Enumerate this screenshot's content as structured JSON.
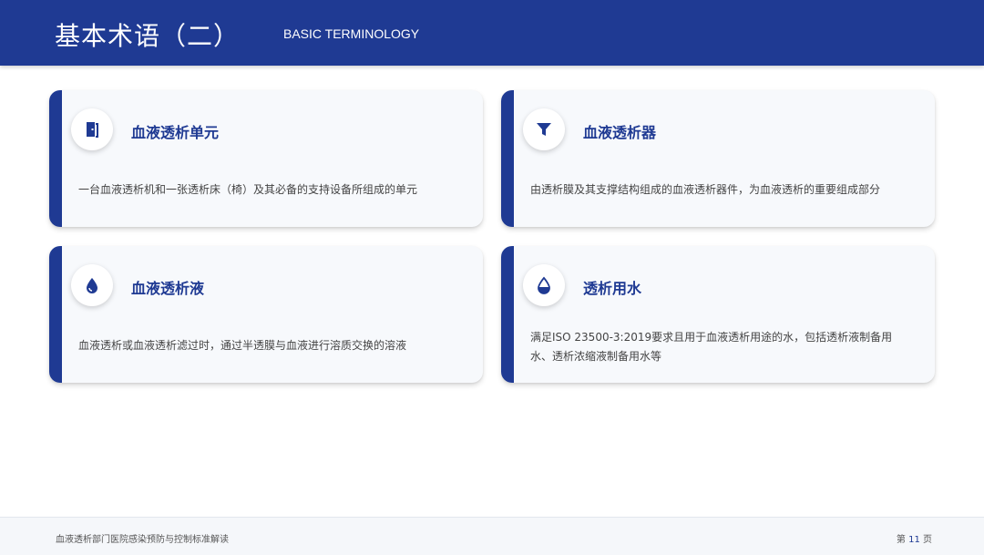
{
  "header": {
    "title": "基本术语（二）",
    "subtitle": "BASIC TERMINOLOGY"
  },
  "cards": [
    {
      "icon": "door-icon",
      "title": "血液透析单元",
      "description": "一台血液透析机和一张透析床（椅）及其必备的支持设备所组成的单元"
    },
    {
      "icon": "filter-icon",
      "title": "血液透析器",
      "description": "由透析膜及其支撑结构组成的血液透析器件，为血液透析的重要组成部分"
    },
    {
      "icon": "drop-icon",
      "title": "血液透析液",
      "description": "血液透析或血液透析滤过时，通过半透膜与血液进行溶质交换的溶液"
    },
    {
      "icon": "half-drop-icon",
      "title": "透析用水",
      "description": "满足ISO 23500-3:2019要求且用于血液透析用途的水，包括透析液制备用水、透析浓缩液制备用水等"
    }
  ],
  "footer": {
    "text": "血液透析部门医院感染预防与控制标准解读",
    "page_prefix": "第",
    "page_number": "11",
    "page_suffix": "页"
  },
  "colors": {
    "primary": "#1f3a93",
    "card_bg": "#f7f9fc"
  }
}
